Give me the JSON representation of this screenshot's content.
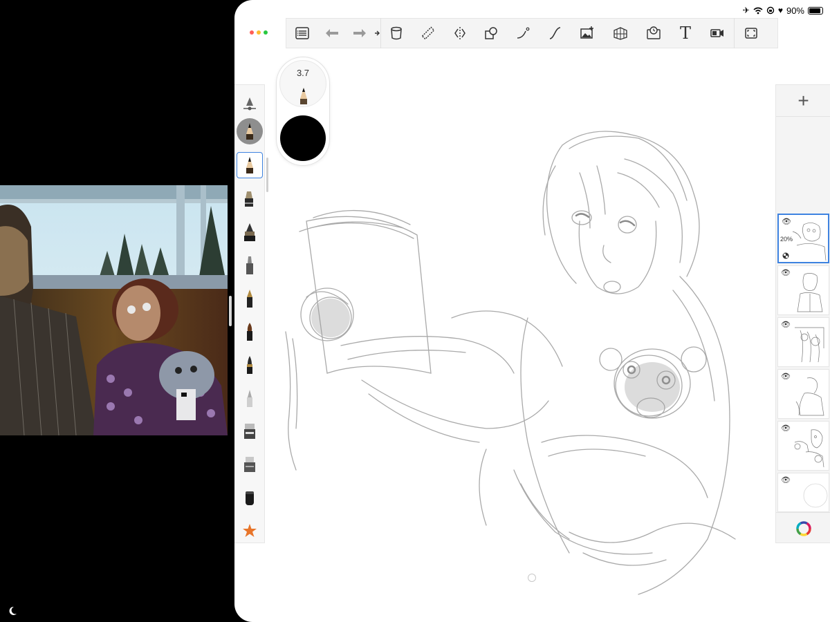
{
  "status_bar": {
    "battery_percent": "90%",
    "battery_level": 0.9,
    "icons": [
      "airplane-icon",
      "wifi-icon",
      "orientation-lock-icon",
      "heart-icon",
      "battery-icon"
    ]
  },
  "window_controls": {
    "dot_colors": [
      "#ff5f57",
      "#febc2e",
      "#28c840"
    ]
  },
  "toolbar": {
    "items": [
      "gallery-icon",
      "undo-icon",
      "redo-icon",
      "more-arrow-icon",
      "bucket-icon",
      "ruler-icon",
      "symmetry-icon",
      "shapes-icon",
      "curve-icon",
      "stroke-icon",
      "image-icon",
      "perspective-icon",
      "timelapse-icon",
      "text-icon",
      "video-icon",
      "fullscreen-icon"
    ],
    "text_tool_label": "T"
  },
  "brush": {
    "size_label": "3.7",
    "color": "#000000"
  },
  "brush_panel": {
    "tools": [
      "brush-settings-icon",
      "pencil-round-icon",
      "pencil-icon",
      "marker-icon",
      "ink-pen-icon",
      "felt-pen-icon",
      "fountain-pen-icon",
      "paint-brush-icon",
      "brush-pen-icon",
      "airbrush-icon",
      "eraser-icon",
      "blender-icon",
      "smudge-icon",
      "favorite-star-icon"
    ],
    "selected_index": 2,
    "star_color": "#e8752a"
  },
  "layers": {
    "add_label": "+",
    "items": [
      {
        "opacity_label": "20%",
        "selected": true
      },
      {
        "opacity_label": "",
        "selected": false
      },
      {
        "opacity_label": "",
        "selected": false
      },
      {
        "opacity_label": "",
        "selected": false
      },
      {
        "opacity_label": "",
        "selected": false
      },
      {
        "opacity_label": "",
        "selected": false
      }
    ]
  },
  "accent_color": "#3d82e0"
}
